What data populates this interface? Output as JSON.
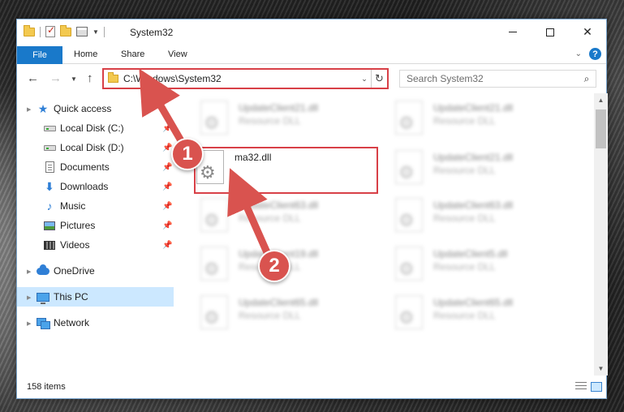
{
  "window": {
    "title": "System32",
    "controls": {
      "minimize_icon": "minimize-icon",
      "maximize_icon": "maximize-icon",
      "close_icon": "close-icon"
    }
  },
  "ribbon": {
    "tabs": [
      {
        "label": "File",
        "active": true
      },
      {
        "label": "Home"
      },
      {
        "label": "Share"
      },
      {
        "label": "View"
      }
    ]
  },
  "navigation": {
    "address_path": "C:\\Windows\\System32",
    "search_placeholder": "Search System32"
  },
  "sidebar": {
    "items": [
      {
        "label": "Quick access",
        "icon": "star-icon"
      },
      {
        "label": "Local Disk (C:)",
        "icon": "drive-icon",
        "pinned": true
      },
      {
        "label": "Local Disk (D:)",
        "icon": "drive-icon",
        "pinned": true
      },
      {
        "label": "Documents",
        "icon": "documents-icon",
        "pinned": true
      },
      {
        "label": "Downloads",
        "icon": "downloads-icon",
        "pinned": true
      },
      {
        "label": "Music",
        "icon": "music-icon",
        "pinned": true
      },
      {
        "label": "Pictures",
        "icon": "pictures-icon",
        "pinned": true
      },
      {
        "label": "Videos",
        "icon": "videos-icon",
        "pinned": true
      },
      {
        "label": "OneDrive",
        "icon": "cloud-icon"
      },
      {
        "label": "This PC",
        "icon": "computer-icon",
        "selected": true
      },
      {
        "label": "Network",
        "icon": "network-icon"
      }
    ]
  },
  "files": [
    {
      "name": "UpdateClient21.dll",
      "type": "Resource DLL",
      "blurred": true
    },
    {
      "name": "UpdateClient21.dll",
      "type": "Resource DLL",
      "blurred": true
    },
    {
      "name": "ma32.dll",
      "type": "",
      "blurred": false
    },
    {
      "name": "UpdateClient21.dll",
      "type": "Resource DLL",
      "blurred": true
    },
    {
      "name": "UpdateClient63.dll",
      "type": "Resource DLL",
      "blurred": true
    },
    {
      "name": "UpdateClient63.dll",
      "type": "Resource DLL",
      "blurred": true
    },
    {
      "name": "UpdateClient19.dll",
      "type": "Resource DLL",
      "blurred": true
    },
    {
      "name": "UpdateClient5.dll",
      "type": "Resource DLL",
      "blurred": true
    },
    {
      "name": "UpdateClient65.dll",
      "type": "Resource DLL",
      "blurred": true
    },
    {
      "name": "UpdateClient65.dll",
      "type": "Resource DLL",
      "blurred": true
    }
  ],
  "status": {
    "item_count": "158 items"
  },
  "annotations": [
    {
      "number": "1",
      "color": "#d9534f"
    },
    {
      "number": "2",
      "color": "#d9534f"
    }
  ],
  "colors": {
    "accent": "#1979ca",
    "highlight": "#d84047",
    "selection": "#cce8ff"
  }
}
